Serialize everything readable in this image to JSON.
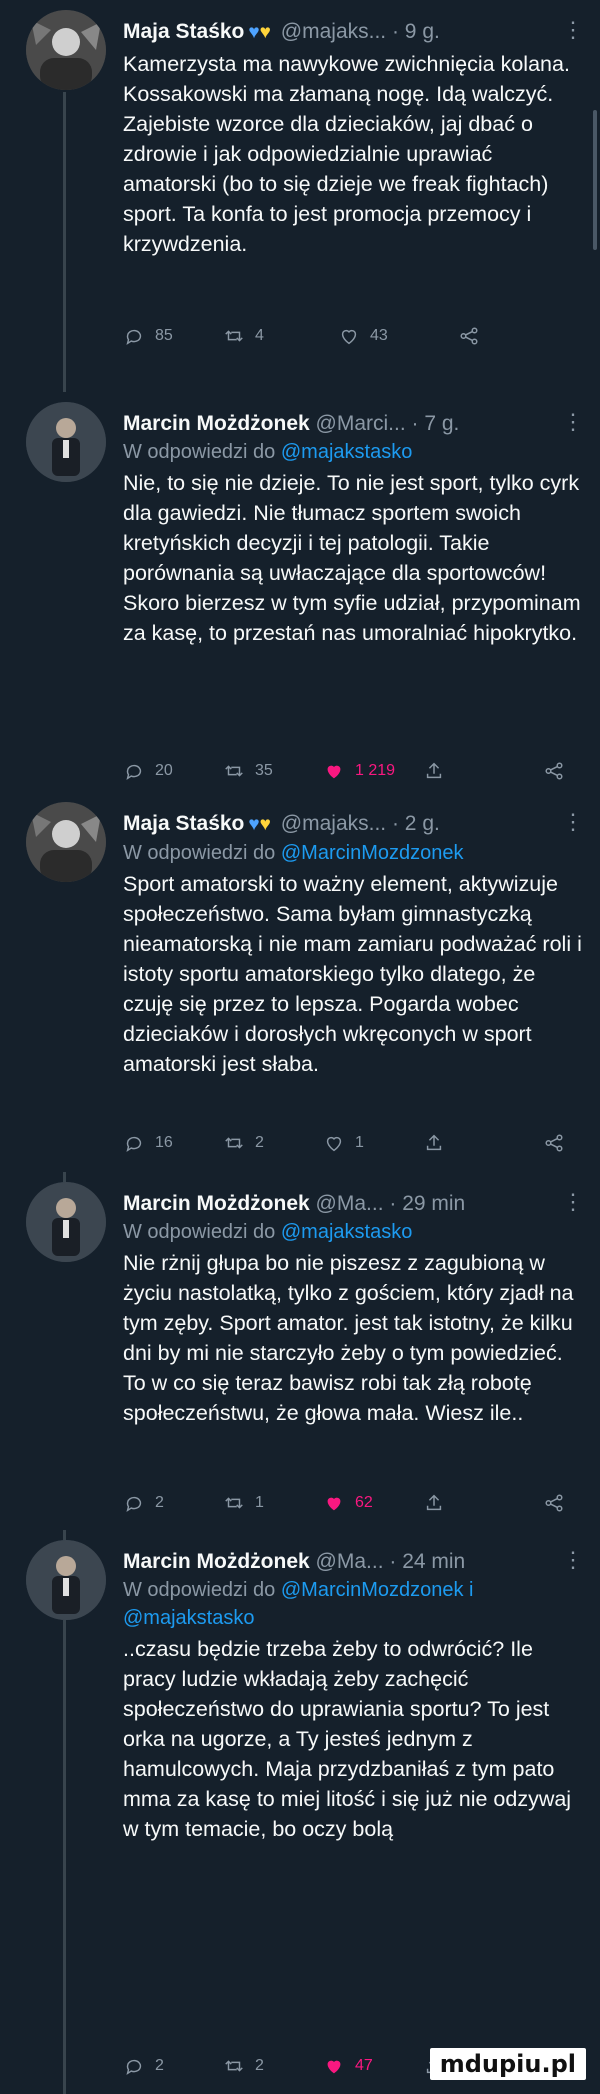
{
  "tweets": [
    {
      "name": "Maja Staśko",
      "handle": "@majaks...",
      "time": "· 9 g.",
      "reply_prefix": "",
      "reply_to": "",
      "reply_to_2": "",
      "text": "Kamerzysta ma nawykowe zwichnięcia kolana. Kossakowski ma złamaną nogę. Idą walczyć. Zajebiste wzorce dla dzieciaków, jaj dbać o zdrowie i jak odpowiedzialnie uprawiać amatorski (bo to się dzieje we freak fightach) sport. Ta konfa to jest promocja przemocy i krzywdzenia.",
      "replies": "85",
      "retweets": "4",
      "likes": "43",
      "liked": false
    },
    {
      "name": "Marcin Możdżonek",
      "handle": "@Marci...",
      "time": "· 7 g.",
      "reply_prefix": "W odpowiedzi do",
      "reply_to": "@majakstasko",
      "reply_to_2": "",
      "text": "Nie, to się nie dzieje. To nie jest sport, tylko cyrk dla gawiedzi. Nie tłumacz sportem swoich kretyńskich decyzji i tej patologii. Takie porównania są uwłaczające dla sportowców! Skoro bierzesz w tym syfie udział, przypominam za kasę, to przestań nas umoralniać hipokrytko.",
      "replies": "20",
      "retweets": "35",
      "likes": "1 219",
      "liked": true
    },
    {
      "name": "Maja Staśko",
      "handle": "@majaks...",
      "time": "· 2 g.",
      "reply_prefix": "W odpowiedzi do",
      "reply_to": "@MarcinMozdzonek",
      "reply_to_2": "",
      "text": "Sport amatorski to ważny element, aktywizuje społeczeństwo. Sama byłam gimnastyczką nieamatorską i nie mam zamiaru podważać roli i istoty sportu amatorskiego tylko dlatego, że czuję się przez to lepsza. Pogarda wobec dzieciaków i dorosłych wkręconych w sport amatorski jest słaba.",
      "replies": "16",
      "retweets": "2",
      "likes": "1",
      "liked": false
    },
    {
      "name": "Marcin Możdżonek",
      "handle": "@Ma...",
      "time": "· 29 min",
      "reply_prefix": "W odpowiedzi do",
      "reply_to": "@majakstasko",
      "reply_to_2": "",
      "text": "Nie rżnij głupa bo nie piszesz z zagubioną w życiu nastolatką, tylko z gościem, który zjadł na tym zęby. Sport amator. jest tak istotny, że kilku dni by mi nie starczyło żeby o tym powiedzieć. To w co się teraz bawisz robi tak złą robotę społeczeństwu, że głowa mała. Wiesz ile..",
      "replies": "2",
      "retweets": "1",
      "likes": "62",
      "liked": true
    },
    {
      "name": "Marcin Możdżonek",
      "handle": "@Ma...",
      "time": "· 24 min",
      "reply_prefix": "W odpowiedzi do",
      "reply_to": "@MarcinMozdzonek i",
      "reply_to_2": "@majakstasko",
      "text": "..czasu będzie trzeba żeby to odwrócić? Ile pracy ludzie wkładają żeby zachęcić społeczeństwo do uprawiania sportu? To jest orka na ugorze, a Ty jesteś jednym z hamulcowych. Maja przydzbaniłaś z tym pato mma za kasę to miej litość i się już nie odzywaj w tym temacie, bo oczy bolą",
      "replies": "2",
      "retweets": "2",
      "likes": "47",
      "liked": true
    }
  ],
  "watermark": "mdupiu.pl",
  "colors": {
    "background": "#15202b",
    "link": "#1d9bf0",
    "muted": "#8b98a5",
    "like": "#f91880",
    "heart_blue": "#4ea3ff",
    "heart_yellow": "#ffd43b"
  },
  "icons": {
    "hearts": "blue-yellow-heart-emoji",
    "reply": "reply-icon",
    "retweet": "retweet-icon",
    "like": "like-icon",
    "share": "share-icon",
    "more": "more-icon"
  }
}
